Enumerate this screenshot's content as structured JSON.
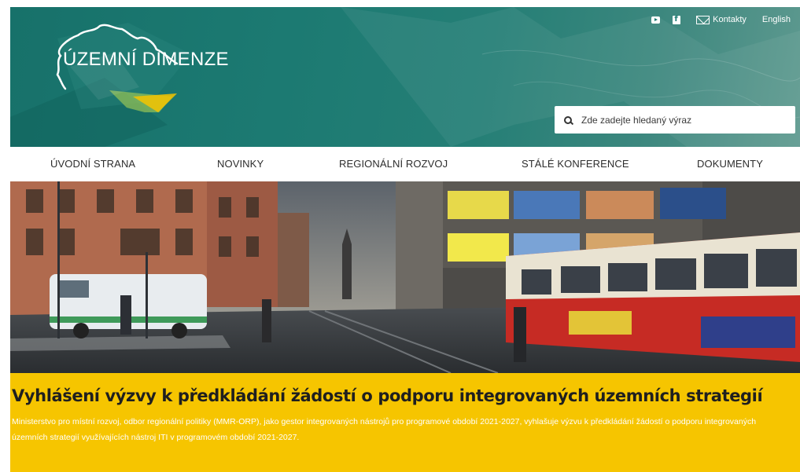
{
  "brand": {
    "name": "ÚZEMNÍ DIMENZE",
    "colors": {
      "header": "#1c7a72",
      "accent_yellow": "#f6c500",
      "nav_text": "#2d2d2d"
    }
  },
  "top_links": {
    "youtube_icon": "youtube-icon",
    "facebook_icon": "facebook-icon",
    "mail_icon": "mail-icon",
    "contacts_label": "Kontakty",
    "language_label": "English"
  },
  "search": {
    "placeholder": "Zde zadejte hledaný výraz",
    "icon": "search-icon"
  },
  "nav": {
    "items": [
      {
        "label": "ÚVODNÍ STRANA"
      },
      {
        "label": "NOVINKY"
      },
      {
        "label": "REGIONÁLNÍ ROZVOJ"
      },
      {
        "label": "STÁLÉ KONFERENCE"
      },
      {
        "label": "DOKUMENTY"
      }
    ]
  },
  "banner": {
    "title": "Vyhlášení výzvy k předkládání žádostí o podporu integrovaných územních strategií",
    "text": "Ministerstvo pro místní rozvoj, odbor regionální politiky (MMR-ORP), jako gestor integrovaných nástrojů pro programové období 2021-2027, vyhlašuje výzvu k předkládání žádostí o podporu integrovaných územních strategií využívajících nástroj ITI v programovém období 2021-2027."
  }
}
